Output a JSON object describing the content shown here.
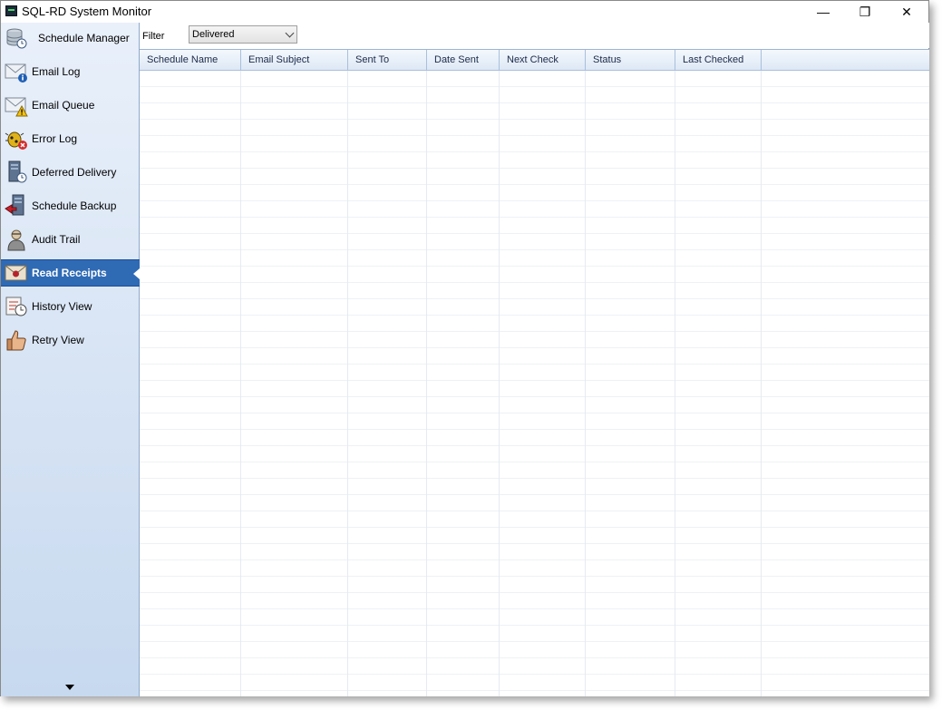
{
  "window": {
    "title": "SQL-RD System Monitor",
    "controls": {
      "minimize": "—",
      "maximize": "❐",
      "close": "✕"
    }
  },
  "sidebar": {
    "items": [
      {
        "label": "Schedule Manager",
        "icon": "database-clock-icon"
      },
      {
        "label": "Email Log",
        "icon": "email-info-icon"
      },
      {
        "label": "Email Queue",
        "icon": "email-warning-icon"
      },
      {
        "label": "Error Log",
        "icon": "bug-error-icon"
      },
      {
        "label": "Deferred Delivery",
        "icon": "server-clock-icon"
      },
      {
        "label": "Schedule Backup",
        "icon": "server-backup-icon"
      },
      {
        "label": "Audit Trail",
        "icon": "auditor-icon"
      },
      {
        "label": "Read Receipts",
        "icon": "envelope-seal-icon",
        "active": true
      },
      {
        "label": "History View",
        "icon": "history-clock-icon"
      },
      {
        "label": "Retry View",
        "icon": "thumbs-up-icon"
      }
    ]
  },
  "filter": {
    "label": "Filter",
    "selected": "Delivered"
  },
  "table": {
    "columns": [
      "Schedule Name",
      "Email Subject",
      "Sent To",
      "Date Sent",
      "Next Check",
      "Status",
      "Last Checked"
    ],
    "rows": []
  },
  "colors": {
    "accent": "#2f6ab5",
    "sidebar_top": "#e9f0fa",
    "sidebar_bottom": "#c7d9ef"
  }
}
